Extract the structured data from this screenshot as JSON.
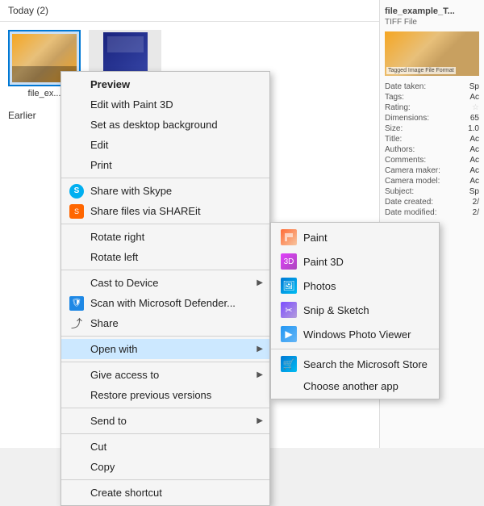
{
  "explorer": {
    "header": "Today (2)",
    "earlier_label": "Earlier",
    "files": [
      {
        "name": "file_ex...",
        "type": "tiff"
      },
      {
        "name": "",
        "type": "book"
      }
    ]
  },
  "right_panel": {
    "title": "file_example_T...",
    "subtitle": "TIFF File",
    "properties": [
      {
        "label": "Date taken:",
        "value": "Sp"
      },
      {
        "label": "Tags:",
        "value": "Ac"
      },
      {
        "label": "Rating:",
        "value": "☆"
      },
      {
        "label": "Dimensions:",
        "value": "65"
      },
      {
        "label": "Size:",
        "value": "1.0"
      },
      {
        "label": "Title:",
        "value": "Ac"
      },
      {
        "label": "Authors:",
        "value": "Ac"
      },
      {
        "label": "Comments:",
        "value": "Ac"
      },
      {
        "label": "Camera maker:",
        "value": "Ac"
      },
      {
        "label": "Camera model:",
        "value": "Ac"
      },
      {
        "label": "Subject:",
        "value": "Sp"
      },
      {
        "label": "Date created:",
        "value": "2/"
      },
      {
        "label": "Date modified:",
        "value": "2/"
      }
    ]
  },
  "context_menu": {
    "items": [
      {
        "id": "preview",
        "label": "Preview",
        "bold": true,
        "icon": null,
        "has_arrow": false
      },
      {
        "id": "edit-paint3d",
        "label": "Edit with Paint 3D",
        "bold": false,
        "icon": null,
        "has_arrow": false
      },
      {
        "id": "set-desktop",
        "label": "Set as desktop background",
        "bold": false,
        "icon": null,
        "has_arrow": false
      },
      {
        "id": "edit",
        "label": "Edit",
        "bold": false,
        "icon": null,
        "has_arrow": false
      },
      {
        "id": "print",
        "label": "Print",
        "bold": false,
        "icon": null,
        "has_arrow": false
      },
      {
        "id": "sep1",
        "type": "separator"
      },
      {
        "id": "share-skype",
        "label": "Share with Skype",
        "bold": false,
        "icon": "skype",
        "has_arrow": false
      },
      {
        "id": "share-shareit",
        "label": "Share files via SHAREit",
        "bold": false,
        "icon": "shareit",
        "has_arrow": false
      },
      {
        "id": "sep2",
        "type": "separator"
      },
      {
        "id": "rotate-right",
        "label": "Rotate right",
        "bold": false,
        "icon": null,
        "has_arrow": false
      },
      {
        "id": "rotate-left",
        "label": "Rotate left",
        "bold": false,
        "icon": null,
        "has_arrow": false
      },
      {
        "id": "sep3",
        "type": "separator"
      },
      {
        "id": "cast",
        "label": "Cast to Device",
        "bold": false,
        "icon": null,
        "has_arrow": true
      },
      {
        "id": "scan-defender",
        "label": "Scan with Microsoft Defender...",
        "bold": false,
        "icon": "defender",
        "has_arrow": false
      },
      {
        "id": "share",
        "label": "Share",
        "bold": false,
        "icon": "share",
        "has_arrow": false
      },
      {
        "id": "sep4",
        "type": "separator"
      },
      {
        "id": "open-with",
        "label": "Open with",
        "bold": false,
        "icon": null,
        "has_arrow": true,
        "highlighted": true
      },
      {
        "id": "sep5",
        "type": "separator"
      },
      {
        "id": "give-access",
        "label": "Give access to",
        "bold": false,
        "icon": null,
        "has_arrow": true
      },
      {
        "id": "restore-versions",
        "label": "Restore previous versions",
        "bold": false,
        "icon": null,
        "has_arrow": false
      },
      {
        "id": "sep6",
        "type": "separator"
      },
      {
        "id": "send-to",
        "label": "Send to",
        "bold": false,
        "icon": null,
        "has_arrow": true
      },
      {
        "id": "sep7",
        "type": "separator"
      },
      {
        "id": "cut",
        "label": "Cut",
        "bold": false,
        "icon": null,
        "has_arrow": false
      },
      {
        "id": "copy",
        "label": "Copy",
        "bold": false,
        "icon": null,
        "has_arrow": false
      },
      {
        "id": "sep8",
        "type": "separator"
      },
      {
        "id": "create-shortcut",
        "label": "Create shortcut",
        "bold": false,
        "icon": null,
        "has_arrow": false
      }
    ]
  },
  "submenu": {
    "items": [
      {
        "id": "paint",
        "label": "Paint",
        "icon": "paint"
      },
      {
        "id": "paint3d",
        "label": "Paint 3D",
        "icon": "paint3d"
      },
      {
        "id": "photos",
        "label": "Photos",
        "icon": "photos"
      },
      {
        "id": "snip",
        "label": "Snip & Sketch",
        "icon": "snip"
      },
      {
        "id": "wpv",
        "label": "Windows Photo Viewer",
        "icon": "wpv"
      },
      {
        "id": "sep",
        "type": "separator"
      },
      {
        "id": "store",
        "label": "Search the Microsoft Store",
        "icon": "store"
      },
      {
        "id": "another",
        "label": "Choose another app",
        "icon": null
      }
    ]
  }
}
